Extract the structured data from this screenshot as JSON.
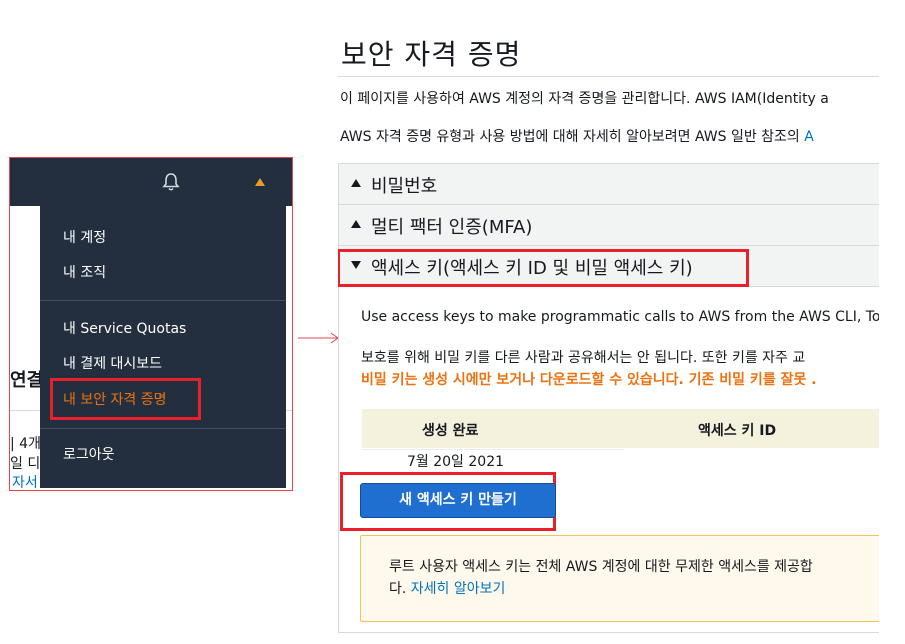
{
  "left_panel": {
    "dropdown": {
      "items_group1": [
        "내 계정",
        "내 조직"
      ],
      "items_group2": [
        "내 Service Quotas",
        "내 결제 대시보드",
        "내 보안 자격 증명"
      ],
      "items_group3": [
        "로그아웃"
      ]
    },
    "behind": {
      "heading": "연결",
      "line1": "| 4개",
      "line2": "일 디",
      "link": "자서"
    },
    "icons": [
      "bell-icon",
      "caret-up-icon"
    ],
    "accent_color": "#ec7211",
    "highlight_color": "#e8202a"
  },
  "right_panel": {
    "title": "보안 자격 증명",
    "intro1": "이 페이지를 사용하여 AWS 계정의 자격 증명을 관리합니다. AWS IAM(Identity a",
    "intro2_text": "AWS 자격 증명 유형과 사용 방법에 대해 자세히 알아보려면 AWS 일반 참조의 ",
    "intro2_link": "A",
    "sections": [
      {
        "label": "비밀번호",
        "expanded": false
      },
      {
        "label": "멀티 팩터 인증(MFA)",
        "expanded": false
      },
      {
        "label": "액세스 키(액세스 키 ID 및 비밀 액세스 키)",
        "expanded": true
      }
    ],
    "access_keys": {
      "description": "Use access keys to make programmatic calls to AWS from the AWS CLI, Too",
      "warning_line1": "보호를 위해 비밀 키를 다른 사람과 공유해서는 안 됩니다. 또한 키를 자주 교",
      "warning_line2": "비밀 키는 생성 시에만 보거나 다운로드할 수 있습니다. 기존 비밀 키를 잘못 .",
      "table": {
        "headers": [
          "생성 완료",
          "액세스 키 ID"
        ],
        "rows": [
          [
            "7월 20일 2021",
            ""
          ]
        ]
      },
      "create_button": "새 액세스 키 만들기",
      "notice_line1": "루트 사용자 액세스 키는 전체 AWS 계정에 대한 무제한 액세스를 제공합",
      "notice_line2_prefix": "다. ",
      "notice_link": "자세히 알아보기"
    },
    "colors": {
      "button": "#1f6fd1",
      "link": "#0073bb",
      "warning": "#ec7211",
      "table_header": "#f4f1dd"
    }
  }
}
